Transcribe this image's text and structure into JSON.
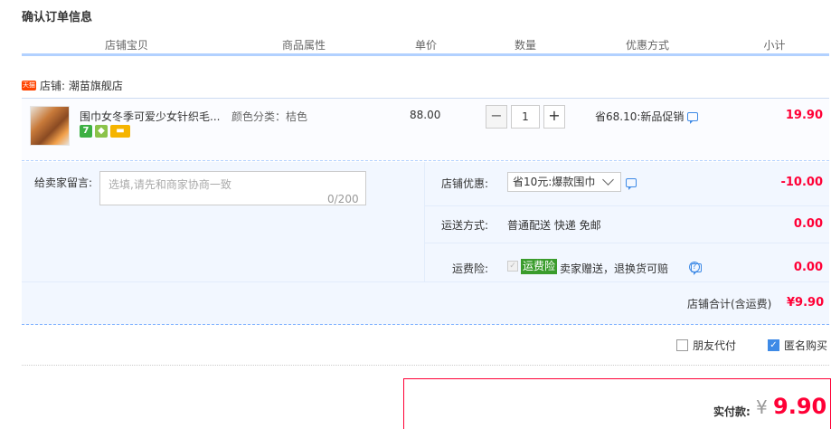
{
  "page_title": "确认订单信息",
  "columns": [
    "店铺宝贝",
    "商品属性",
    "单价",
    "数量",
    "优惠方式",
    "小计"
  ],
  "shop": {
    "badge": "天猫",
    "label": "店铺: 潮苗旗舰店"
  },
  "item": {
    "title": "围巾女冬季可爱少女针织毛...",
    "attr": "颜色分类：桔色",
    "icon_7": "7",
    "price": "88.00",
    "qty_minus": "−",
    "qty": "1",
    "qty_plus": "+",
    "promo": "省68.10:新品促销",
    "subtotal": "19.90"
  },
  "message": {
    "label": "给卖家留言:",
    "placeholder": "选填,请先和商家协商一致",
    "count": "0/200"
  },
  "shop_discount": {
    "label": "店铺优惠:",
    "selected": "省10元:爆款围巾",
    "value": "-10.00"
  },
  "shipping": {
    "label": "运送方式:",
    "text": "普通配送 快递 免邮",
    "value": "0.00"
  },
  "insurance": {
    "label": "运费险:",
    "check": "✓",
    "badge": "运费险",
    "text": "卖家赠送，退换货可赔",
    "help": "?",
    "value": "0.00"
  },
  "shop_total": {
    "label": "店铺合计(含运费)",
    "value": "¥9.90"
  },
  "options": {
    "friend_pay": "朋友代付",
    "anonymous": "匿名购买",
    "anonymous_check": "✓"
  },
  "pay": {
    "label": "实付款:",
    "currency": "¥",
    "value": "9.90"
  }
}
